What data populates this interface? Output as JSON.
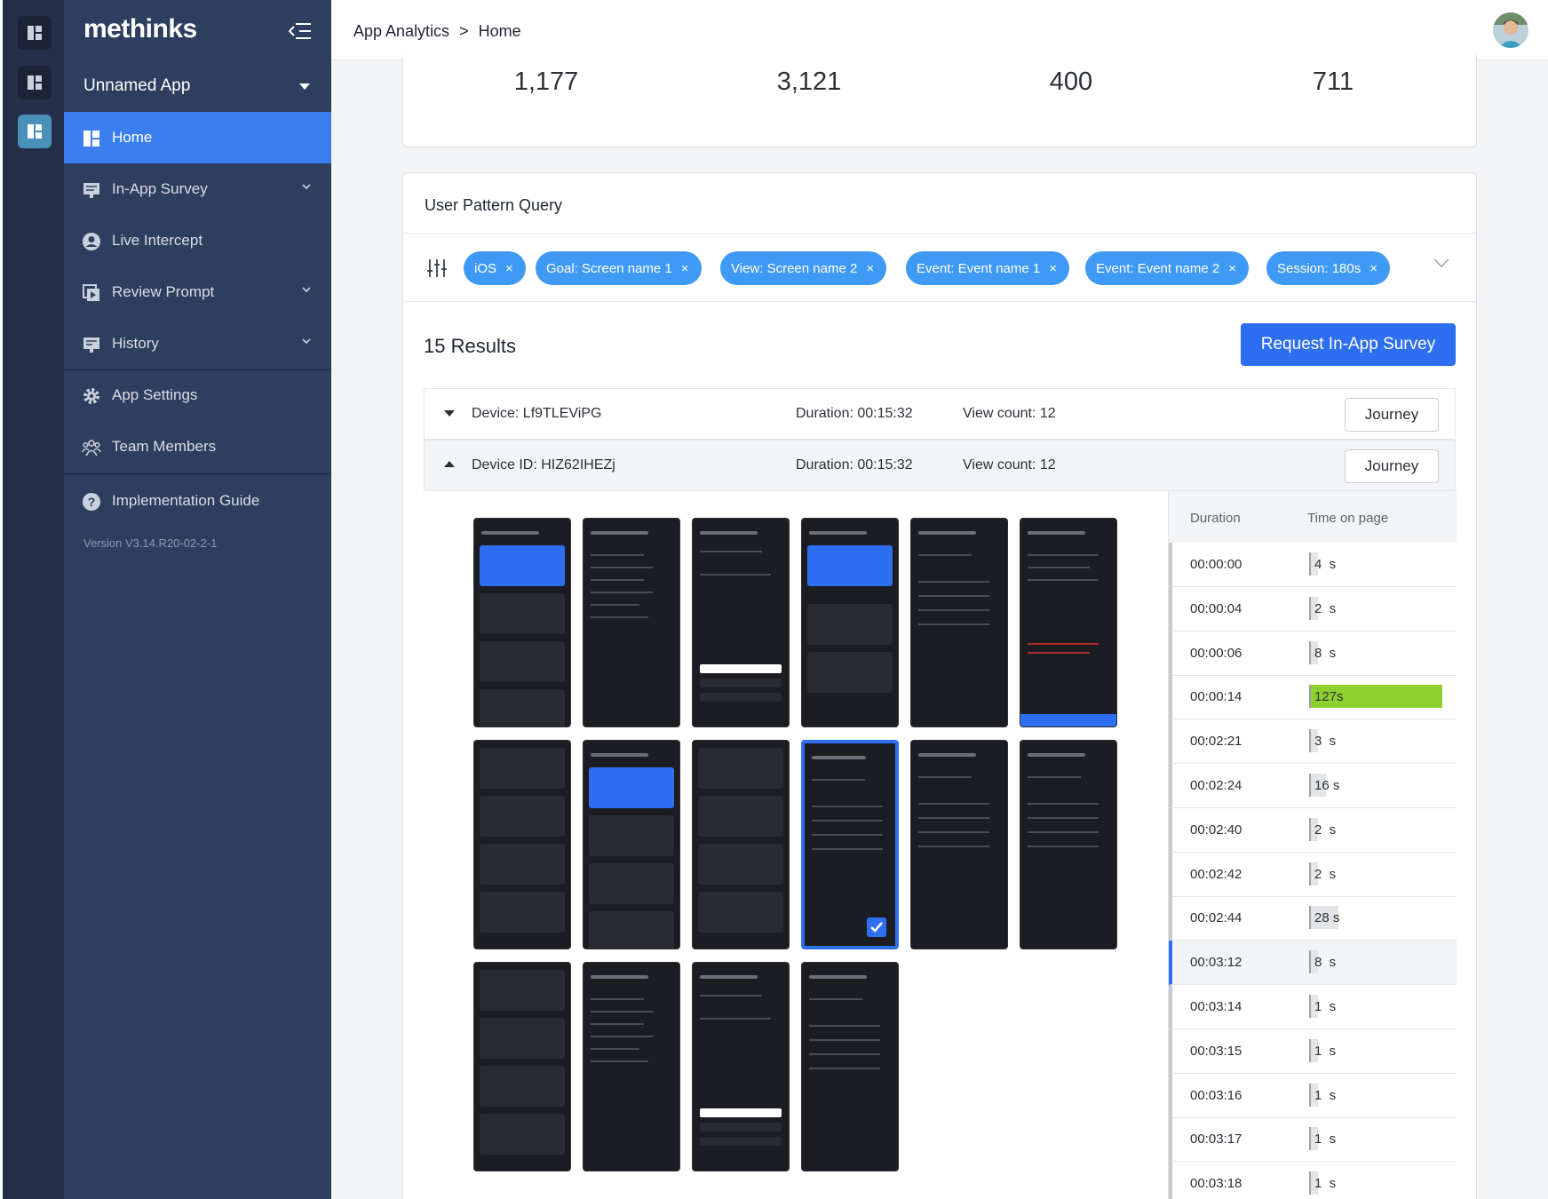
{
  "brand": {
    "logo_text": "methinks"
  },
  "app_selector": {
    "value": "Unnamed App"
  },
  "nav": {
    "home": "Home",
    "in_app_survey": "In-App Survey",
    "live_intercept": "Live Intercept",
    "review_prompt": "Review Prompt",
    "history": "History",
    "app_settings": "App Settings",
    "team_members": "Team Members",
    "implementation_guide": "Implementation Guide",
    "version": "Version V3.14.R20-02-2-1"
  },
  "breadcrumb": {
    "parent": "App Analytics",
    "separator": ">",
    "current": "Home"
  },
  "stats": [
    "1,177",
    "3,121",
    "400",
    "711"
  ],
  "query": {
    "title": "User Pattern Query",
    "filters": [
      "iOS",
      "Goal: Screen name 1",
      "View: Screen name 2",
      "Event: Event name 1",
      "Event: Event name 2",
      "Session: 180s"
    ],
    "remove_glyph": "×"
  },
  "results": {
    "title": "15 Results",
    "request_button": "Request In-App Survey",
    "devices": [
      {
        "label": "Device: Lf9TLEViPG",
        "duration": "Duration: 00:15:32",
        "view_count": "View count: 12",
        "journey": "Journey",
        "expanded": false
      },
      {
        "label": "Device ID: HIZ62IHEZj",
        "duration": "Duration: 00:15:32",
        "view_count": "View count: 12",
        "journey": "Journey",
        "expanded": true
      }
    ]
  },
  "timeline": {
    "col_duration": "Duration",
    "col_time_on_page": "Time on page",
    "rows": [
      {
        "time": "00:00:00",
        "value": "4  s",
        "seconds": 4
      },
      {
        "time": "00:00:04",
        "value": "2  s",
        "seconds": 2
      },
      {
        "time": "00:00:06",
        "value": "8  s",
        "seconds": 8
      },
      {
        "time": "00:00:14",
        "value": "127s",
        "seconds": 127
      },
      {
        "time": "00:02:21",
        "value": "3  s",
        "seconds": 3
      },
      {
        "time": "00:02:24",
        "value": "16 s",
        "seconds": 16
      },
      {
        "time": "00:02:40",
        "value": "2  s",
        "seconds": 2
      },
      {
        "time": "00:02:42",
        "value": "2  s",
        "seconds": 2
      },
      {
        "time": "00:02:44",
        "value": "28 s",
        "seconds": 28
      },
      {
        "time": "00:03:12",
        "value": "8  s",
        "seconds": 8,
        "current": true
      },
      {
        "time": "00:03:14",
        "value": "1  s",
        "seconds": 1
      },
      {
        "time": "00:03:15",
        "value": "1  s",
        "seconds": 1
      },
      {
        "time": "00:03:16",
        "value": "1  s",
        "seconds": 1
      },
      {
        "time": "00:03:17",
        "value": "1  s",
        "seconds": 1
      },
      {
        "time": "00:03:18",
        "value": "1  s",
        "seconds": 1
      }
    ]
  },
  "colors": {
    "accent": "#3a7ef0",
    "chip": "#3f9af5",
    "highlight_bar": "#8fd12c",
    "sidebar": "#2e3e5e"
  }
}
